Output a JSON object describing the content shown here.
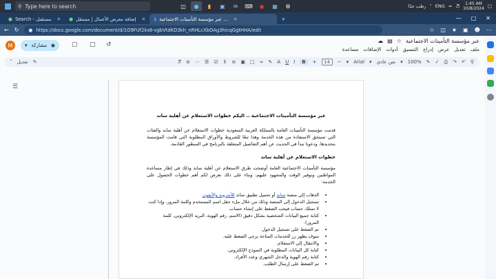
{
  "taskbar": {
    "search_placeholder": "Type here to search",
    "lang": "ENG",
    "time": "1:45 AM",
    "date": "10/8/2024",
    "weather": "رطب جدًا"
  },
  "browser": {
    "tabs": [
      {
        "label": "Search - مستقبل"
      },
      {
        "label": "إضافة معرض الأعمال | مستقل"
      },
      {
        "label": "عبر مؤسسة التأمينات الاجتماعية ..."
      }
    ],
    "url": "https://docs.google.com/document/d/1O9FUf2ks6-vgbVtdKD3kh_nRHLcXbOAg3hicqGgtHHA/edit"
  },
  "docs": {
    "title": "عبر مؤسسة التأمينات الاجتماعية",
    "menus": [
      "ملف",
      "تعديل",
      "عرض",
      "إدراج",
      "التنسيق",
      "أدوات",
      "الإضافات",
      "مساعدة"
    ],
    "share_label": "مشاركة",
    "avatar_letter": "M"
  },
  "toolbar": {
    "zoom": "100%",
    "style": "نص عادي",
    "font": "Arial",
    "font_size": "14",
    "bold": "B",
    "mode": "تعديل"
  },
  "document": {
    "title": "عبر مؤسسة التأمينات الاجتماعية .. اليكم خطوات الاستعلام عن أهلية ساند",
    "intro": "قدمت مؤسسة التأمينات العامة بالمملكة العربية السعودية خطوات الاستعلام عن أهلية ساند والفئات التي تستحق الاستفادة من هذه الخدمة وهذا تبعًا للشروط والأوراق المطلوبة التي قامت المؤسسة بتحديدها، ودعونا نبدأ في الحديث عن أهم التفاصيل المتعلقة بالبرنامج في السطور القادمة.",
    "section_heading": "خطوات الاستعلام عن أهلية ساند",
    "section_intro": "مؤسسة التأمينات الاجتماعية العامة أوضحت طرق الاستعلام عن أهلية ساند وذلك في إطار مساعدة المواطنين وتوفير الوقت والمجهود عليهم، وبناء على ذلك نعرض لكم أهم خطوات الحصول على الخدمة:",
    "step1_prefix": "الذهاب إلى منصة ",
    "step1_link1": "ساند",
    "step1_mid": " أو تحميل تطبيق ساند ",
    "step1_link2": "للأندرويد والآيفون",
    "steps": [
      "تسجيل الدخول إلى المنصة وذلك من خلال ملء حقل اسم المستخدم وكلمة المرور، وإذا كنت لا تمتلك حساب فيجب الضغط على إنشاء حساب.",
      "كتابة جميع البيانات الشخصية بشكل دقيق (الاسم، رقم الهوية، البريد الإلكتروني، كلمة المرور).",
      "تم الضغط على تسجيل الدخول.",
      "سوف يظهر زر للخدمات المتاحة يرجى الضغط عليه.",
      "والانتقال إلى الاستعلام.",
      "كتابة كل البيانات المطلوبة في النموذج الإلكتروني.",
      "كتابة رقم الهوية والدخل الشهري وعدد الأفراد.",
      "تم الضغط على إرسال الطلب."
    ]
  }
}
